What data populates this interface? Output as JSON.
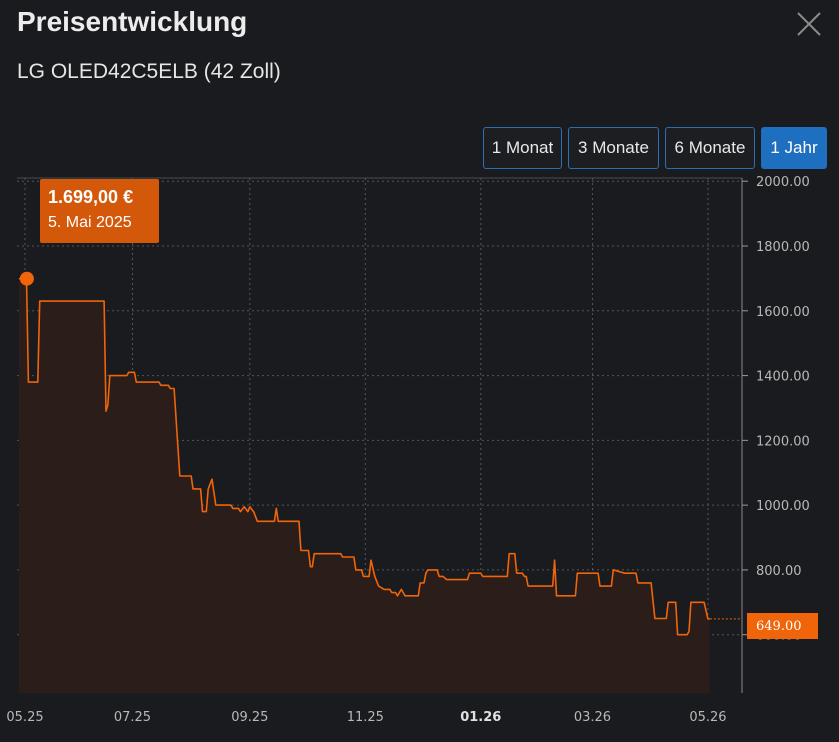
{
  "header": {
    "title": "Preisentwicklung",
    "subtitle": "LG OLED42C5ELB (42 Zoll)"
  },
  "range_buttons": [
    {
      "label": "1 Monat",
      "active": false
    },
    {
      "label": "3 Monate",
      "active": false
    },
    {
      "label": "6 Monate",
      "active": false
    },
    {
      "label": "1 Jahr",
      "active": true
    }
  ],
  "tooltip": {
    "price": "1.699,00 €",
    "date": "5. Mai 2025"
  },
  "last_price_label": "649.00",
  "colors": {
    "line": "#f0640a",
    "tooltip_bg": "#d4580a",
    "active_button": "#1f6fc0",
    "background": "#1a1b1e"
  },
  "chart_data": {
    "type": "line",
    "y_ticks": [
      "2000.00",
      "1800.00",
      "1600.00",
      "1400.00",
      "1200.00",
      "1000.00",
      "800.00",
      "600.00"
    ],
    "ylim": [
      420,
      2010
    ],
    "xlim": [
      "2025-05-01",
      "2026-05-19"
    ],
    "x_ticks": [
      {
        "label": "05.25",
        "date": "2025-05-01",
        "bold": false
      },
      {
        "label": "07.25",
        "date": "2025-07-01",
        "bold": false
      },
      {
        "label": "09.25",
        "date": "2025-09-01",
        "bold": false
      },
      {
        "label": "11.25",
        "date": "2025-11-01",
        "bold": false
      },
      {
        "label": "01.26",
        "date": "2026-01-01",
        "bold": true
      },
      {
        "label": "03.26",
        "date": "2026-03-01",
        "bold": false
      },
      {
        "label": "05.26",
        "date": "2026-05-01",
        "bold": false
      }
    ],
    "points": [
      [
        "2025-05-02",
        1699
      ],
      [
        "2025-05-06",
        1699
      ],
      [
        "2025-05-07",
        1380
      ],
      [
        "2025-05-12",
        1380
      ],
      [
        "2025-05-13",
        1630
      ],
      [
        "2025-06-16",
        1630
      ],
      [
        "2025-06-17",
        1290
      ],
      [
        "2025-06-18",
        1310
      ],
      [
        "2025-06-19",
        1400
      ],
      [
        "2025-06-28",
        1400
      ],
      [
        "2025-06-29",
        1410
      ],
      [
        "2025-07-02",
        1410
      ],
      [
        "2025-07-03",
        1380
      ],
      [
        "2025-07-15",
        1380
      ],
      [
        "2025-07-16",
        1370
      ],
      [
        "2025-07-20",
        1370
      ],
      [
        "2025-07-21",
        1360
      ],
      [
        "2025-07-23",
        1360
      ],
      [
        "2025-07-26",
        1090
      ],
      [
        "2025-08-01",
        1090
      ],
      [
        "2025-08-02",
        1050
      ],
      [
        "2025-08-06",
        1050
      ],
      [
        "2025-08-07",
        980
      ],
      [
        "2025-08-09",
        980
      ],
      [
        "2025-08-10",
        1050
      ],
      [
        "2025-08-12",
        1080
      ],
      [
        "2025-08-14",
        1000
      ],
      [
        "2025-08-22",
        1000
      ],
      [
        "2025-08-23",
        990
      ],
      [
        "2025-08-26",
        990
      ],
      [
        "2025-08-27",
        980
      ],
      [
        "2025-08-29",
        995
      ],
      [
        "2025-08-31",
        980
      ],
      [
        "2025-09-01",
        995
      ],
      [
        "2025-09-03",
        980
      ],
      [
        "2025-09-05",
        950
      ],
      [
        "2025-09-14",
        950
      ],
      [
        "2025-09-15",
        990
      ],
      [
        "2025-09-16",
        950
      ],
      [
        "2025-09-27",
        950
      ],
      [
        "2025-09-28",
        860
      ],
      [
        "2025-10-02",
        860
      ],
      [
        "2025-10-03",
        810
      ],
      [
        "2025-10-04",
        810
      ],
      [
        "2025-10-05",
        850
      ],
      [
        "2025-10-19",
        850
      ],
      [
        "2025-10-20",
        840
      ],
      [
        "2025-10-26",
        840
      ],
      [
        "2025-10-27",
        800
      ],
      [
        "2025-10-30",
        800
      ],
      [
        "2025-10-31",
        780
      ],
      [
        "2025-11-03",
        780
      ],
      [
        "2025-11-04",
        830
      ],
      [
        "2025-11-06",
        780
      ],
      [
        "2025-11-08",
        750
      ],
      [
        "2025-11-11",
        740
      ],
      [
        "2025-11-14",
        740
      ],
      [
        "2025-11-15",
        730
      ],
      [
        "2025-11-17",
        730
      ],
      [
        "2025-11-18",
        720
      ],
      [
        "2025-11-20",
        740
      ],
      [
        "2025-11-22",
        720
      ],
      [
        "2025-11-29",
        720
      ],
      [
        "2025-11-30",
        760
      ],
      [
        "2025-12-02",
        760
      ],
      [
        "2025-12-03",
        790
      ],
      [
        "2025-12-04",
        800
      ],
      [
        "2025-12-09",
        800
      ],
      [
        "2025-12-10",
        780
      ],
      [
        "2025-12-12",
        780
      ],
      [
        "2025-12-14",
        770
      ],
      [
        "2025-12-25",
        770
      ],
      [
        "2025-12-26",
        790
      ],
      [
        "2026-01-01",
        790
      ],
      [
        "2026-01-02",
        780
      ],
      [
        "2026-01-15",
        780
      ],
      [
        "2026-01-16",
        850
      ],
      [
        "2026-01-19",
        850
      ],
      [
        "2026-01-20",
        790
      ],
      [
        "2026-01-23",
        790
      ],
      [
        "2026-01-24",
        780
      ],
      [
        "2026-01-25",
        780
      ],
      [
        "2026-01-26",
        750
      ],
      [
        "2026-02-08",
        750
      ],
      [
        "2026-02-09",
        830
      ],
      [
        "2026-02-10",
        720
      ],
      [
        "2026-02-20",
        720
      ],
      [
        "2026-02-21",
        790
      ],
      [
        "2026-02-24",
        790
      ],
      [
        "2026-03-04",
        790
      ],
      [
        "2026-03-05",
        750
      ],
      [
        "2026-03-09",
        750
      ],
      [
        "2026-03-11",
        750
      ],
      [
        "2026-03-12",
        800
      ],
      [
        "2026-03-18",
        790
      ],
      [
        "2026-03-19",
        790
      ],
      [
        "2026-03-23",
        790
      ],
      [
        "2026-03-24",
        790
      ],
      [
        "2026-03-25",
        760
      ],
      [
        "2026-03-27",
        760
      ],
      [
        "2026-03-30",
        760
      ],
      [
        "2026-04-01",
        760
      ],
      [
        "2026-04-03",
        650
      ],
      [
        "2026-04-05",
        650
      ],
      [
        "2026-04-09",
        650
      ],
      [
        "2026-04-10",
        700
      ],
      [
        "2026-04-12",
        700
      ],
      [
        "2026-04-14",
        700
      ],
      [
        "2026-04-15",
        600
      ],
      [
        "2026-04-18",
        600
      ],
      [
        "2026-04-20",
        600
      ],
      [
        "2026-04-21",
        610
      ],
      [
        "2026-04-22",
        700
      ],
      [
        "2026-04-28",
        700
      ],
      [
        "2026-04-29",
        700
      ],
      [
        "2026-05-01",
        649
      ],
      [
        "2026-05-02",
        649
      ]
    ]
  }
}
